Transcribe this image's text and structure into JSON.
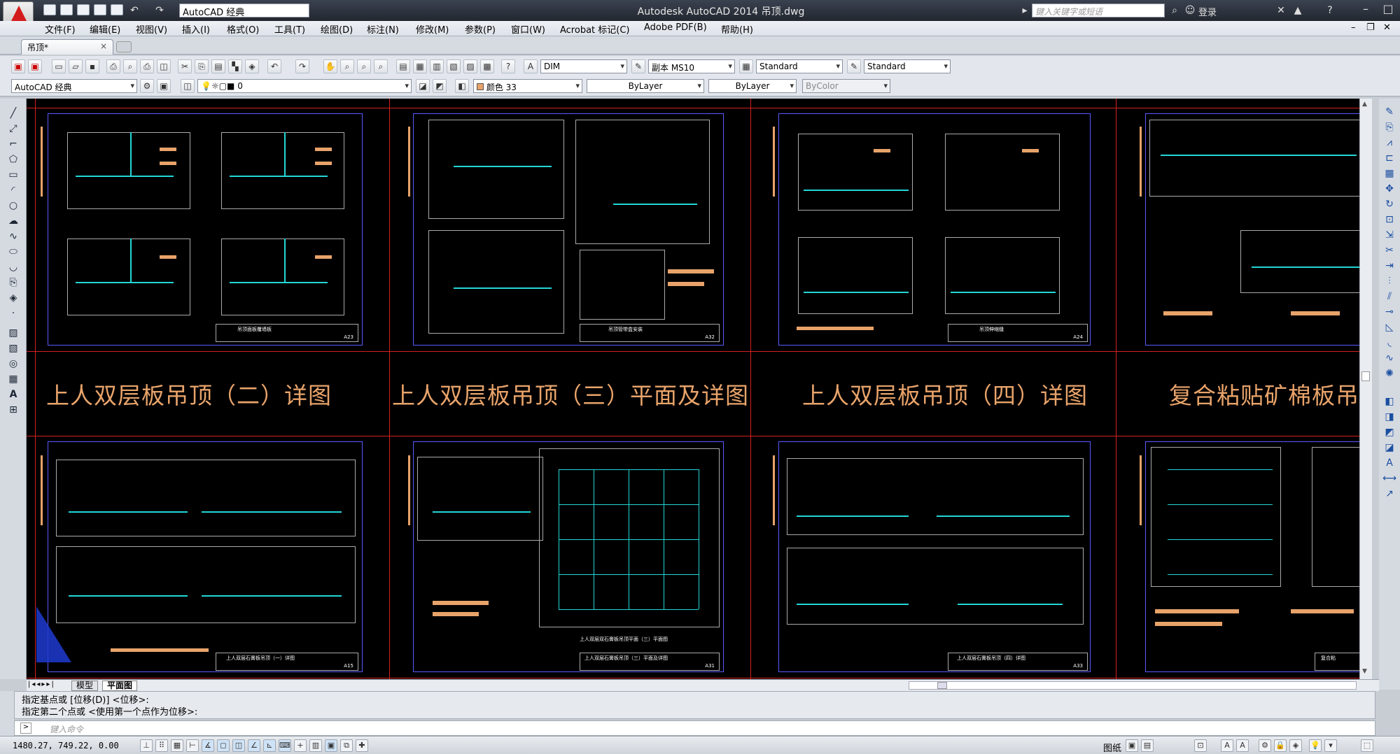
{
  "app": {
    "window_title": "Autodesk AutoCAD 2014    吊顶.dwg",
    "workspace": "AutoCAD 经典",
    "search_placeholder": "键入关键字或短语",
    "login": "登录"
  },
  "menu": [
    "文件(F)",
    "编辑(E)",
    "视图(V)",
    "插入(I)",
    "格式(O)",
    "工具(T)",
    "绘图(D)",
    "标注(N)",
    "修改(M)",
    "参数(P)",
    "窗口(W)",
    "Acrobat 标记(C)",
    "Adobe PDF(B)",
    "帮助(H)"
  ],
  "doc_tab": {
    "label": "吊顶*"
  },
  "toolbar": {
    "dim_style": "DIM",
    "text_style": "副本 MS10",
    "table_style": "Standard",
    "mleader_style": "Standard",
    "workspace2": "AutoCAD 经典",
    "layer": "0",
    "color": "颜色 33",
    "linetype": "ByLayer",
    "lineweight": "ByLayer",
    "plotstyle": "ByColor"
  },
  "drawing": {
    "titles": [
      "上人双层板吊顶（二）详图",
      "上人双层板吊顶（三）平面及详图",
      "上人双层板吊顶（四）详图",
      "复合粘贴矿棉板吊"
    ],
    "top_sheet_labels": [
      "吊顶面板覆墙板",
      "吊顶管带盒安装",
      "吊顶伸缩缝"
    ],
    "bottom_sheet_labels": [
      "上人双层石膏板吊顶（一）详图",
      "上人双层石膏板吊顶（三）平面及详图",
      "上人双层石膏板吊顶（四）详图",
      "复合粘"
    ],
    "plan_caption": "上人双层双石膏板吊顶平面（三）平面图",
    "sheet_numbers": [
      "A23",
      "A32",
      "A24",
      "A15",
      "A31",
      "A33"
    ]
  },
  "layout_tabs": [
    "模型",
    "平面图"
  ],
  "command": {
    "history": [
      "指定基点或 [位移(D)] <位移>:",
      "指定第二个点或 <使用第一个点作为位移>:"
    ],
    "input_placeholder": "键入命令"
  },
  "status": {
    "coords": "1480.27, 749.22, 0.00",
    "paper_label": "图纸"
  }
}
